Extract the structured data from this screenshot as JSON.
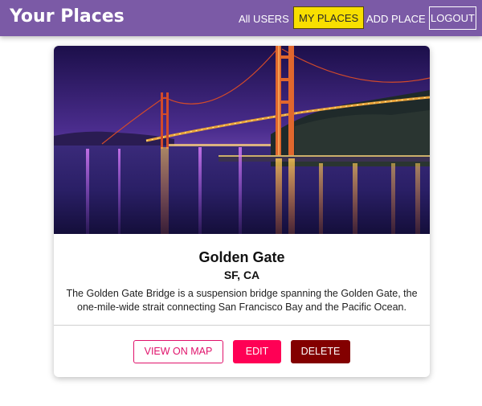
{
  "header": {
    "title": "Your Places",
    "nav": {
      "all_users": "All USERS",
      "my_places": "MY PLACES",
      "add_place": "ADD PLACE",
      "logout": "LOGOUT"
    }
  },
  "place": {
    "title": "Golden Gate",
    "location": "SF, CA",
    "description": "The Golden Gate Bridge is a suspension bridge spanning the Golden Gate, the one-mile-wide strait connecting San Francisco Bay and the Pacific Ocean.",
    "actions": {
      "view_on_map": "VIEW ON MAP",
      "edit": "EDIT",
      "delete": "DELETE"
    }
  },
  "colors": {
    "header": "#7b5aa6",
    "active_nav": "#f8df00",
    "primary": "#ff0055",
    "danger": "#830000"
  }
}
